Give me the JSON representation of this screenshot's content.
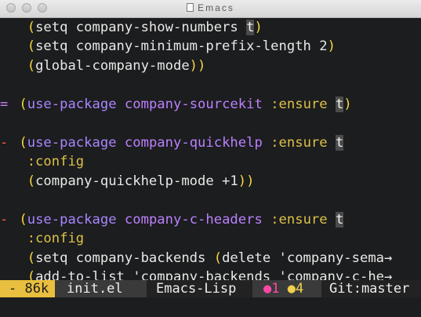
{
  "window": {
    "title": "Emacs"
  },
  "editor": {
    "lines": [
      {
        "gutter": "",
        "indent": "  ",
        "parts": [
          [
            "p",
            "("
          ],
          [
            "c",
            "setq company-show-numbers "
          ],
          [
            "cursor",
            "t"
          ],
          [
            "p",
            ")"
          ]
        ]
      },
      {
        "gutter": "",
        "indent": "  ",
        "parts": [
          [
            "p",
            "("
          ],
          [
            "c",
            "setq company-minimum-prefix-length 2"
          ],
          [
            "p",
            ")"
          ]
        ]
      },
      {
        "gutter": "",
        "indent": "  ",
        "parts": [
          [
            "p",
            "("
          ],
          [
            "c",
            "global-company-mode"
          ],
          [
            "p",
            "))"
          ]
        ]
      },
      {
        "gutter": "",
        "indent": "",
        "parts": []
      },
      {
        "gutter": "=",
        "indent": " ",
        "parts": [
          [
            "p",
            "("
          ],
          [
            "k",
            "use-package"
          ],
          [
            "c",
            " "
          ],
          [
            "n",
            "company-sourcekit"
          ],
          [
            "c",
            " "
          ],
          [
            "kw",
            ":ensure"
          ],
          [
            "c",
            " "
          ],
          [
            "cursor",
            "t"
          ],
          [
            "p",
            ")"
          ]
        ]
      },
      {
        "gutter": "",
        "indent": "",
        "parts": []
      },
      {
        "gutter": "-",
        "indent": " ",
        "parts": [
          [
            "p",
            "("
          ],
          [
            "k",
            "use-package"
          ],
          [
            "c",
            " "
          ],
          [
            "n",
            "company-quickhelp"
          ],
          [
            "c",
            " "
          ],
          [
            "kw",
            ":ensure"
          ],
          [
            "c",
            " "
          ],
          [
            "cursor",
            "t"
          ]
        ]
      },
      {
        "gutter": "",
        "indent": "  ",
        "parts": [
          [
            "kw",
            ":config"
          ]
        ]
      },
      {
        "gutter": "",
        "indent": "  ",
        "parts": [
          [
            "p",
            "("
          ],
          [
            "c",
            "company-quickhelp-mode +1"
          ],
          [
            "p",
            "))"
          ]
        ]
      },
      {
        "gutter": "",
        "indent": "",
        "parts": []
      },
      {
        "gutter": "-",
        "indent": " ",
        "parts": [
          [
            "p",
            "("
          ],
          [
            "k",
            "use-package"
          ],
          [
            "c",
            " "
          ],
          [
            "n",
            "company-c-headers"
          ],
          [
            "c",
            " "
          ],
          [
            "kw",
            ":ensure"
          ],
          [
            "c",
            " "
          ],
          [
            "cursor",
            "t"
          ]
        ]
      },
      {
        "gutter": "",
        "indent": "  ",
        "parts": [
          [
            "kw",
            ":config"
          ]
        ]
      },
      {
        "gutter": "",
        "indent": "  ",
        "parts": [
          [
            "p",
            "("
          ],
          [
            "c",
            "setq company-backends "
          ],
          [
            "p",
            "("
          ],
          [
            "c",
            "delete 'company-sema"
          ],
          [
            "trunc",
            "→"
          ]
        ]
      },
      {
        "gutter": "",
        "indent": "  ",
        "parts": [
          [
            "p",
            "("
          ],
          [
            "c",
            "add-to-list 'company-backends 'company-c-he"
          ],
          [
            "trunc",
            "→"
          ]
        ]
      }
    ]
  },
  "modeline": {
    "position": "- 86k",
    "buffer": "init.el",
    "major_mode": "Emacs-Lisp",
    "flycheck_errors": "●1",
    "flycheck_warnings": "●4",
    "vcs": "Git:master"
  },
  "colors": {
    "background": "#1c1d1e",
    "paren": "#f6d744",
    "keyword": "#a985ff",
    "package": "#bb80ff",
    "property": "#dcc14a",
    "modeline_accent": "#e8bf3e"
  }
}
